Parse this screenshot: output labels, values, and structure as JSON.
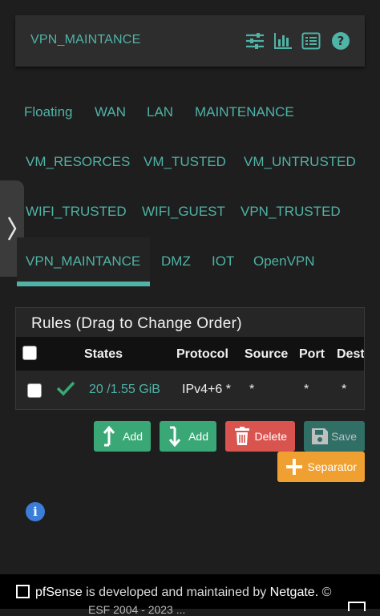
{
  "header": {
    "title": "VPN_MAINTANCE",
    "icons": [
      "sliders-icon",
      "chart-icon",
      "list-icon",
      "help-icon"
    ]
  },
  "tabs": [
    {
      "label": "Floating"
    },
    {
      "label": "WAN"
    },
    {
      "label": "LAN"
    },
    {
      "label": "MAINTENANCE"
    },
    {
      "label": "VM_RESORCES"
    },
    {
      "label": "VM_TUSTED"
    },
    {
      "label": "VM_UNTRUSTED"
    },
    {
      "label": "WIFI_TRUSTED"
    },
    {
      "label": "WIFI_GUEST"
    },
    {
      "label": "VPN_TRUSTED"
    },
    {
      "label": "VPN_MAINTANCE",
      "active": true
    },
    {
      "label": "DMZ"
    },
    {
      "label": "IOT"
    },
    {
      "label": "OpenVPN"
    }
  ],
  "rules": {
    "title": "Rules (Drag to Change Order)",
    "columns": [
      "States",
      "Protocol",
      "Source",
      "Port",
      "Dest"
    ],
    "rows": [
      {
        "states": "20 /1.55 GiB",
        "protocol": "IPv4+6 *",
        "source": "*",
        "port": "*",
        "dest": "*"
      }
    ]
  },
  "buttons": {
    "add_top": "Add",
    "add_bottom": "Add",
    "delete": "Delete",
    "save": "Save",
    "separator": "Separator"
  },
  "footer": {
    "brand": "pfSense",
    "middle": " is developed and maintained by ",
    "company": "Netgate.",
    "copyright": " ©",
    "partial": "ESF 2004 - 2023 ..."
  },
  "colors": {
    "accent": "#4fb3a6",
    "success": "#3aa876",
    "danger": "#d9534f",
    "warning": "#f0a030",
    "info": "#3b7dd8"
  }
}
